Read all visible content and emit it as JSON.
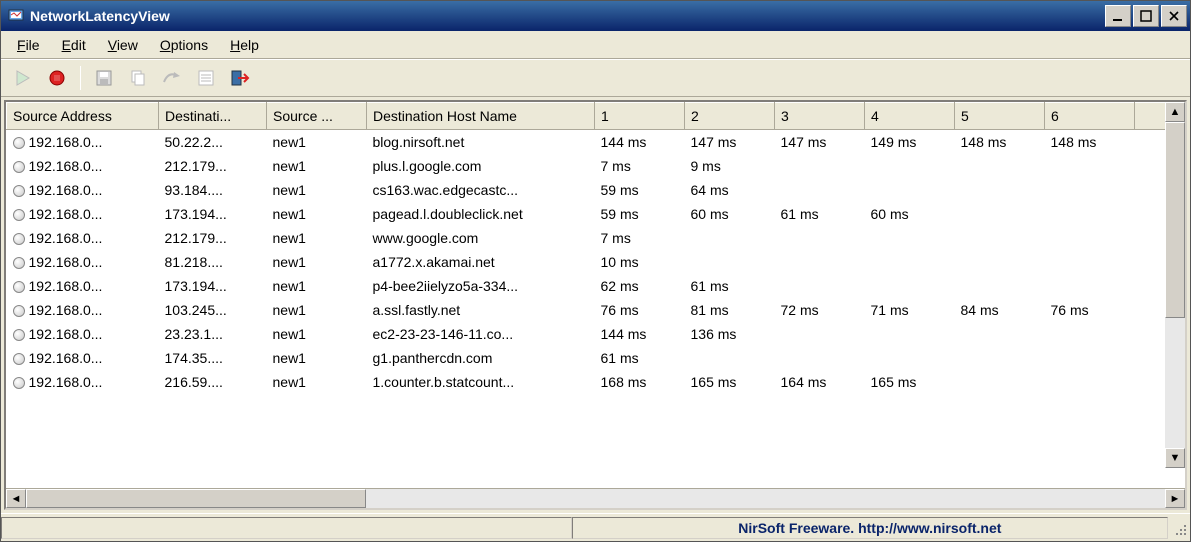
{
  "window": {
    "title": "NetworkLatencyView"
  },
  "menu": {
    "file": "File",
    "edit": "Edit",
    "view": "View",
    "options": "Options",
    "help": "Help"
  },
  "toolbar": {
    "play": "play-icon",
    "stop": "stop-icon",
    "save": "save-icon",
    "copy": "copy-icon",
    "jump": "jump-icon",
    "props": "properties-icon",
    "exit": "exit-icon"
  },
  "columns": [
    "Source Address",
    "Destinati...",
    "Source ...",
    "Destination Host Name",
    "1",
    "2",
    "3",
    "4",
    "5",
    "6"
  ],
  "rows": [
    {
      "src": "192.168.0...",
      "dst": "50.22.2...",
      "srcn": "new1",
      "host": "blog.nirsoft.net",
      "l": [
        "144 ms",
        "147 ms",
        "147 ms",
        "149 ms",
        "148 ms",
        "148 ms"
      ]
    },
    {
      "src": "192.168.0...",
      "dst": "212.179...",
      "srcn": "new1",
      "host": "plus.l.google.com",
      "l": [
        "7 ms",
        "9 ms",
        "",
        "",
        "",
        ""
      ]
    },
    {
      "src": "192.168.0...",
      "dst": "93.184....",
      "srcn": "new1",
      "host": "cs163.wac.edgecastc...",
      "l": [
        "59 ms",
        "64 ms",
        "",
        "",
        "",
        ""
      ]
    },
    {
      "src": "192.168.0...",
      "dst": "173.194...",
      "srcn": "new1",
      "host": "pagead.l.doubleclick.net",
      "l": [
        "59 ms",
        "60 ms",
        "61 ms",
        "60 ms",
        "",
        ""
      ]
    },
    {
      "src": "192.168.0...",
      "dst": "212.179...",
      "srcn": "new1",
      "host": "www.google.com",
      "l": [
        "7 ms",
        "",
        "",
        "",
        "",
        ""
      ]
    },
    {
      "src": "192.168.0...",
      "dst": "81.218....",
      "srcn": "new1",
      "host": "a1772.x.akamai.net",
      "l": [
        "10 ms",
        "",
        "",
        "",
        "",
        ""
      ]
    },
    {
      "src": "192.168.0...",
      "dst": "173.194...",
      "srcn": "new1",
      "host": "p4-bee2iielyzo5a-334...",
      "l": [
        "62 ms",
        "61 ms",
        "",
        "",
        "",
        ""
      ]
    },
    {
      "src": "192.168.0...",
      "dst": "103.245...",
      "srcn": "new1",
      "host": "a.ssl.fastly.net",
      "l": [
        "76 ms",
        "81 ms",
        "72 ms",
        "71 ms",
        "84 ms",
        "76 ms"
      ]
    },
    {
      "src": "192.168.0...",
      "dst": "23.23.1...",
      "srcn": "new1",
      "host": "ec2-23-23-146-11.co...",
      "l": [
        "144 ms",
        "136 ms",
        "",
        "",
        "",
        ""
      ]
    },
    {
      "src": "192.168.0...",
      "dst": "174.35....",
      "srcn": "new1",
      "host": "g1.panthercdn.com",
      "l": [
        "61 ms",
        "",
        "",
        "",
        "",
        ""
      ]
    },
    {
      "src": "192.168.0...",
      "dst": "216.59....",
      "srcn": "new1",
      "host": "1.counter.b.statcount...",
      "l": [
        "168 ms",
        "165 ms",
        "164 ms",
        "165 ms",
        "",
        ""
      ]
    }
  ],
  "status": {
    "freeware": "NirSoft Freeware.  http://www.nirsoft.net"
  }
}
